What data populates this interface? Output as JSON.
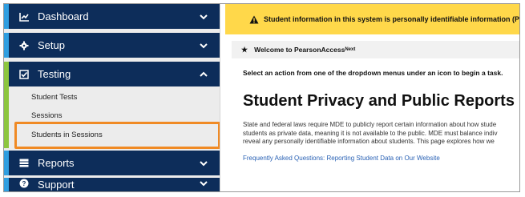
{
  "sidebar": {
    "dashboard": {
      "label": "Dashboard",
      "icon": "chart-line-icon"
    },
    "setup": {
      "label": "Setup",
      "icon": "gear-icon"
    },
    "testing": {
      "label": "Testing",
      "icon": "checkbox-icon",
      "expanded": true,
      "subitems": [
        "Student Tests",
        "Sessions",
        "Students in Sessions"
      ]
    },
    "reports": {
      "label": "Reports",
      "icon": "report-list-icon"
    },
    "support": {
      "label": "Support",
      "icon": "question-circle-icon"
    }
  },
  "banner": {
    "text": "Student information in this system is personally identifiable information (PII)",
    "icon": "warning-icon"
  },
  "welcome": {
    "prefix": "Welcome to PearsonAccess",
    "superscript": "Next",
    "icon": "star-icon"
  },
  "main": {
    "instruction": "Select an action from one of the dropdown menus under an icon to begin a task.",
    "title": "Student Privacy and Public Reports",
    "paragraph_lines": [
      "State and federal laws require MDE to publicly report certain information about how stude",
      "students as private data, meaning it is not available to the public. MDE must balance indiv",
      "reveal any personally identifiable information about students. This page explores how we"
    ],
    "faq_link": "Frequently Asked Questions: Reporting Student Data on Our Website"
  },
  "colors": {
    "nav_bg": "#0d2d5a",
    "accent_blue": "#2f9ee0",
    "accent_green": "#8dc63f",
    "banner_yellow": "#ffd84a",
    "highlight_orange": "#f08a24",
    "link_blue": "#2a62b5"
  }
}
